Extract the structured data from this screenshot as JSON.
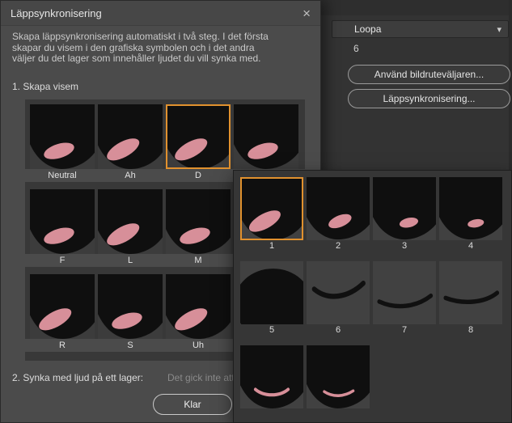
{
  "icons": {
    "close": "×",
    "chevron_down": "▾"
  },
  "colors": {
    "accent_orange": "#e1912e",
    "tongue_pink": "#d78f99"
  },
  "background_panel": {
    "loop_dropdown_value": "Loopa",
    "frame_number": "6",
    "use_frame_picker_button": "Använd bildruteväljaren...",
    "lip_sync_button": "Läppsynkronisering..."
  },
  "dialog": {
    "title": "Läppsynkronisering",
    "description_lines": [
      "Skapa läppsynkronisering automatiskt i två steg. I det första",
      "skapar du visem i den grafiska symbolen och i det andra",
      "väljer du det lager som innehåller ljudet du vill synka med."
    ],
    "step1_label": "1. Skapa visem",
    "step2_label": "2. Synka med ljud på ett lager:",
    "audio_status_text": "Det gick inte att",
    "done_button": "Klar",
    "viseme_rows": [
      [
        {
          "label": "Neutral",
          "variant": "open2",
          "selected": false
        },
        {
          "label": "Ah",
          "variant": "open1",
          "selected": false
        },
        {
          "label": "D",
          "variant": "open1",
          "selected": true
        },
        {
          "label": "",
          "variant": "open2",
          "selected": false
        }
      ],
      [
        {
          "label": "F",
          "variant": "open2",
          "selected": false
        },
        {
          "label": "L",
          "variant": "open1",
          "selected": false
        },
        {
          "label": "M",
          "variant": "open2",
          "selected": false
        }
      ],
      [
        {
          "label": "R",
          "variant": "open1",
          "selected": false
        },
        {
          "label": "S",
          "variant": "open2",
          "selected": false
        },
        {
          "label": "Uh",
          "variant": "open1",
          "selected": false
        }
      ]
    ]
  },
  "frame_picker": {
    "rows": [
      [
        {
          "label": "1",
          "variant": "open1",
          "selected": true
        },
        {
          "label": "2",
          "variant": "open3",
          "selected": false
        },
        {
          "label": "3",
          "variant": "open4",
          "selected": false
        },
        {
          "label": "4",
          "variant": "open5",
          "selected": false
        }
      ],
      [
        {
          "label": "5",
          "variant": "dark",
          "selected": false
        },
        {
          "label": "6",
          "variant": "closed1",
          "selected": false
        },
        {
          "label": "7",
          "variant": "closed2",
          "selected": false
        },
        {
          "label": "8",
          "variant": "closed3",
          "selected": false
        }
      ],
      [
        {
          "label": "",
          "variant": "thin1",
          "selected": false
        },
        {
          "label": "",
          "variant": "thin2",
          "selected": false
        }
      ]
    ]
  }
}
